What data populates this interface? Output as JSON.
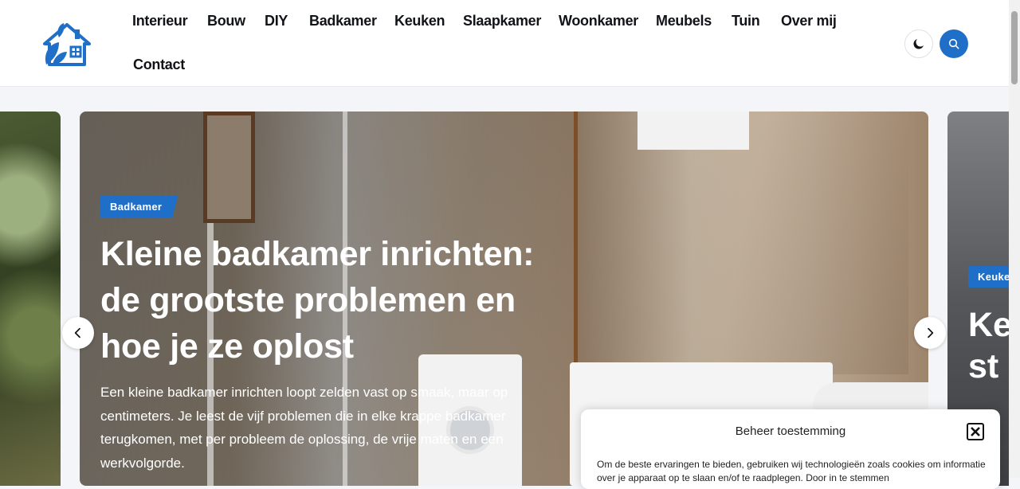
{
  "header": {
    "nav": [
      "Interieur",
      "Bouw",
      "DIY",
      "Badkamer",
      "Keuken",
      "Slaapkamer",
      "Woonkamer",
      "Meubels",
      "Tuin",
      "Over mij",
      "Contact"
    ],
    "dark_mode_icon": "moon-icon",
    "search_icon": "search-icon",
    "accent_color": "#1f6fc8"
  },
  "slider": {
    "main": {
      "category": "Badkamer",
      "title": "Kleine badkamer inrichten: de grootste problemen en hoe je ze oplost",
      "excerpt": "Een kleine badkamer inrichten loopt zelden vast op smaak, maar op centimeters. Je leest de vijf problemen die in elke krappe badkamer terugkomen, met per probleem de oplossing, de vrije maten en een werkvolgorde."
    },
    "next": {
      "category": "Keuken",
      "title_partial": "Ke st"
    },
    "prev_icon": "chevron-left-icon",
    "next_icon": "chevron-right-icon"
  },
  "consent": {
    "title": "Beheer toestemming",
    "text": "Om de beste ervaringen te bieden, gebruiken wij technologieën zoals cookies om informatie over je apparaat op te slaan en/of te raadplegen. Door in te stemmen",
    "close_icon": "close-icon"
  }
}
